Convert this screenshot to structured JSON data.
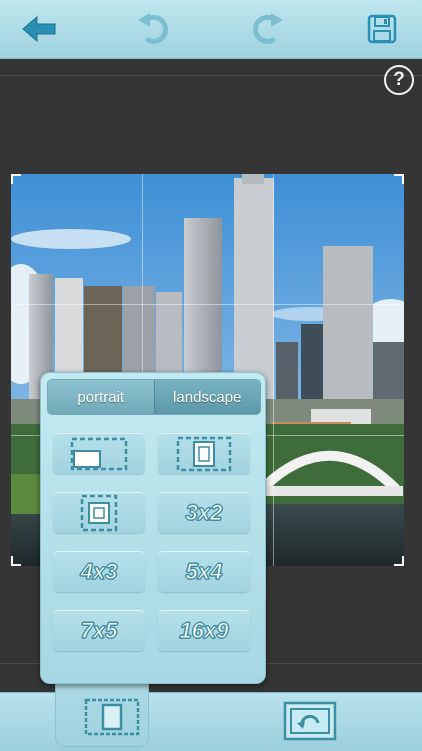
{
  "toolbar": {
    "back_icon": "back-arrow-icon",
    "undo_icon": "undo-icon",
    "redo_icon": "redo-icon",
    "save_icon": "save-disk-icon",
    "accent_color": "#2a8fb4"
  },
  "help": {
    "label": "?"
  },
  "crop_panel": {
    "tabs": [
      {
        "label": "portrait",
        "active": true
      },
      {
        "label": "landscape",
        "active": false
      }
    ],
    "ratio_options": [
      "3x2",
      "4x3",
      "5x4",
      "7x5",
      "16x9"
    ],
    "icon_options": [
      "free-crop-icon",
      "original-ratio-icon",
      "square-crop-icon"
    ]
  },
  "bottom_bar": {
    "crop_icon": "crop-frame-icon",
    "rotate_icon": "rotate-frame-icon"
  }
}
